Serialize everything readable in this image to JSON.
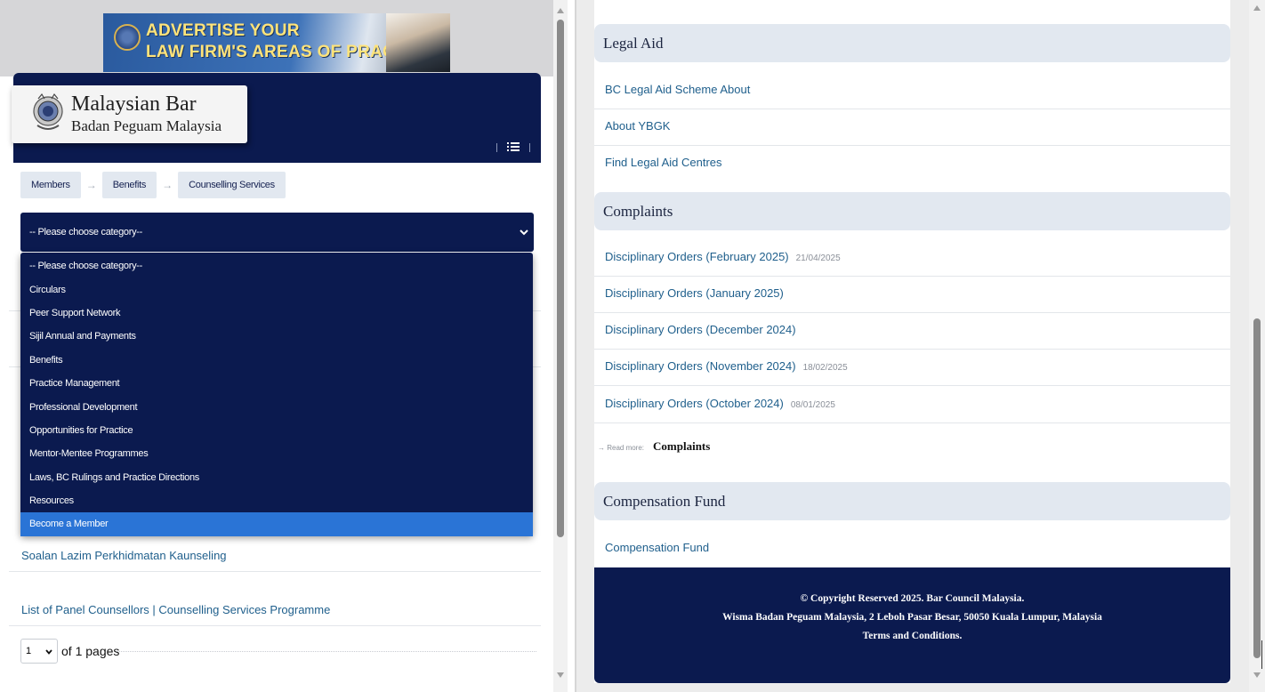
{
  "ad": {
    "line1": "ADVERTISE YOUR",
    "line2": "LAW FIRM'S AREAS OF PRACTICE"
  },
  "logo": {
    "name": "Malaysian Bar",
    "sub": "Badan Peguam Malaysia"
  },
  "breadcrumb": [
    "Members",
    "Benefits",
    "Counselling Services"
  ],
  "category_select": {
    "selected": "-- Please choose category--",
    "options": [
      "-- Please choose category--",
      "Circulars",
      "Peer Support Network",
      "Sijil Annual and Payments",
      "Benefits",
      "Practice Management",
      "Professional Development",
      "Opportunities for Practice",
      "Mentor-Mentee Programmes",
      "Laws, BC Rulings and Practice Directions",
      "Resources",
      "Become a Member"
    ],
    "highlighted": "Become a Member"
  },
  "left_list": {
    "faq": "Soalan Lazim Perkhidmatan Kaunseling",
    "panel": "List of Panel Counsellors | Counselling Services Programme"
  },
  "pager": {
    "page": "1",
    "suffix": "of 1 pages"
  },
  "legal_aid": {
    "title": "Legal Aid",
    "links": [
      "BC Legal Aid Scheme About",
      "About YBGK",
      "Find Legal Aid Centres"
    ]
  },
  "complaints": {
    "title": "Complaints",
    "items": [
      {
        "label": "Disciplinary Orders (February 2025)",
        "date": "21/04/2025"
      },
      {
        "label": "Disciplinary Orders (January 2025)",
        "date": ""
      },
      {
        "label": "Disciplinary Orders (December 2024)",
        "date": ""
      },
      {
        "label": "Disciplinary Orders (November 2024)",
        "date": "18/02/2025"
      },
      {
        "label": "Disciplinary Orders (October 2024)",
        "date": "08/01/2025"
      }
    ],
    "read_more_label": "→ Read more:",
    "read_more_target": "Complaints"
  },
  "compensation": {
    "title": "Compensation Fund",
    "links": [
      "Compensation Fund"
    ]
  },
  "footer": {
    "copyright": "© Copyright Reserved 2025. Bar Council Malaysia.",
    "address": "Wisma Badan Peguam Malaysia, 2 Leboh Pasar Besar, 50050 Kuala Lumpur, Malaysia",
    "terms": "Terms and Conditions."
  },
  "colors": {
    "navy": "#0b1a4f",
    "link": "#1f5f8c",
    "section_bg": "#e2e8f0",
    "highlight": "#2a74d6"
  },
  "icons": [
    "menu-list-icon",
    "chevron-down-icon",
    "crest-icon",
    "breadcrumb-arrow-icon"
  ]
}
